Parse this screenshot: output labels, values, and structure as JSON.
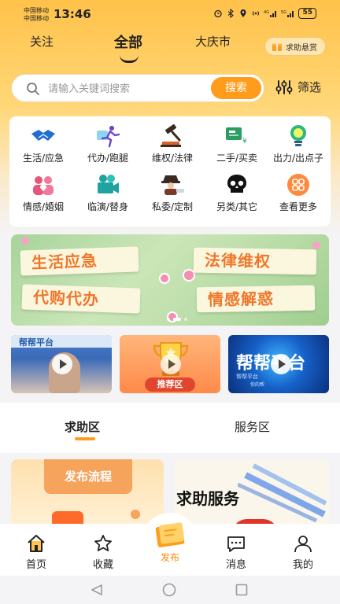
{
  "status_bar": {
    "carrier_1": "中国移动",
    "carrier_2": "中国移动",
    "time": "13:46",
    "battery": "55"
  },
  "top_tabs": [
    {
      "label": "关注"
    },
    {
      "label": "全部",
      "active": true
    },
    {
      "label": "大庆市"
    }
  ],
  "help_reward": {
    "label": "求助悬赏"
  },
  "search": {
    "placeholder": "请输入关键词搜索",
    "button": "搜索"
  },
  "filter": {
    "label": "筛选"
  },
  "categories": [
    {
      "label": "生活/应急",
      "icon": "handshake-icon"
    },
    {
      "label": "代办/跑腿",
      "icon": "runner-icon"
    },
    {
      "label": "维权/法律",
      "icon": "gavel-icon"
    },
    {
      "label": "二手/买卖",
      "icon": "trade-icon"
    },
    {
      "label": "出力/出点子",
      "icon": "lightbulb-icon"
    },
    {
      "label": "情感/婚姻",
      "icon": "couple-icon"
    },
    {
      "label": "临演/替身",
      "icon": "video-camera-icon"
    },
    {
      "label": "私委/定制",
      "icon": "detective-icon"
    },
    {
      "label": "另类/其它",
      "icon": "skull-icon"
    },
    {
      "label": "查看更多",
      "icon": "grid-more-icon"
    }
  ],
  "banner": {
    "cards": [
      "生活应急",
      "法律维权",
      "代购代办",
      "情感解惑"
    ],
    "page_count": 3,
    "active_page": 2
  },
  "thumbs": [
    {
      "label": "帮帮平台"
    },
    {
      "label": "推荐区"
    },
    {
      "label": "帮帮平台",
      "sublabel_1": "帮帮平台",
      "sublabel_2": "你的帮"
    }
  ],
  "section_tabs": [
    {
      "label": "求助区",
      "active": true
    },
    {
      "label": "服务区"
    }
  ],
  "info_cards": {
    "left_title": "发布流程",
    "right_title": "求助服务"
  },
  "bottom_nav": [
    {
      "label": "首页",
      "icon": "home-icon"
    },
    {
      "label": "收藏",
      "icon": "star-icon"
    },
    {
      "label": "发布",
      "icon": "publish-note-icon"
    },
    {
      "label": "消息",
      "icon": "message-icon"
    },
    {
      "label": "我的",
      "icon": "profile-icon"
    }
  ],
  "colors": {
    "accent": "#ff9c1b",
    "brand_yellow": "#ffc24a",
    "banner_text": "#f0762a"
  }
}
